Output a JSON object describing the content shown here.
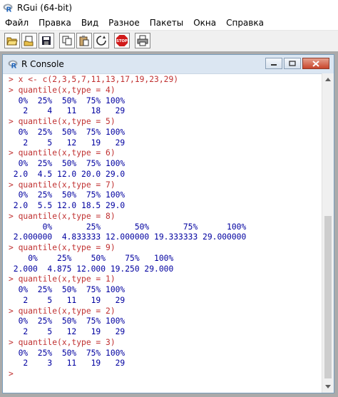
{
  "app": {
    "title": "RGui (64-bit)"
  },
  "menu": [
    "Файл",
    "Правка",
    "Вид",
    "Разное",
    "Пакеты",
    "Окна",
    "Справка"
  ],
  "toolbar": {
    "buttons": [
      "open-script-icon",
      "load-workspace-icon",
      "save-icon",
      "copy-icon",
      "paste-icon",
      "copy-paste-icon",
      "stop-icon",
      "print-icon"
    ],
    "stop_label": "STOP"
  },
  "console": {
    "title": "R Console",
    "lines": [
      {
        "type": "prompt",
        "text": "> x <- c(2,3,5,7,11,13,17,19,23,29)"
      },
      {
        "type": "prompt",
        "text": "> quantile(x,type = 4)"
      },
      {
        "type": "output",
        "text": "  0%  25%  50%  75% 100%"
      },
      {
        "type": "output",
        "text": "   2    4   11   18   29"
      },
      {
        "type": "prompt",
        "text": "> quantile(x,type = 5)"
      },
      {
        "type": "output",
        "text": "  0%  25%  50%  75% 100%"
      },
      {
        "type": "output",
        "text": "   2    5   12   19   29"
      },
      {
        "type": "prompt",
        "text": "> quantile(x,type = 6)"
      },
      {
        "type": "output",
        "text": "  0%  25%  50%  75% 100%"
      },
      {
        "type": "output",
        "text": " 2.0  4.5 12.0 20.0 29.0"
      },
      {
        "type": "prompt",
        "text": "> quantile(x,type = 7)"
      },
      {
        "type": "output",
        "text": "  0%  25%  50%  75% 100%"
      },
      {
        "type": "output",
        "text": " 2.0  5.5 12.0 18.5 29.0"
      },
      {
        "type": "prompt",
        "text": "> quantile(x,type = 8)"
      },
      {
        "type": "output",
        "text": "       0%       25%       50%       75%      100%"
      },
      {
        "type": "output",
        "text": " 2.000000  4.833333 12.000000 19.333333 29.000000"
      },
      {
        "type": "prompt",
        "text": "> quantile(x,type = 9)"
      },
      {
        "type": "output",
        "text": "    0%    25%    50%    75%   100%"
      },
      {
        "type": "output",
        "text": " 2.000  4.875 12.000 19.250 29.000"
      },
      {
        "type": "prompt",
        "text": "> quantile(x,type = 1)"
      },
      {
        "type": "output",
        "text": "  0%  25%  50%  75% 100%"
      },
      {
        "type": "output",
        "text": "   2    5   11   19   29"
      },
      {
        "type": "prompt",
        "text": "> quantile(x,type = 2)"
      },
      {
        "type": "output",
        "text": "  0%  25%  50%  75% 100%"
      },
      {
        "type": "output",
        "text": "   2    5   12   19   29"
      },
      {
        "type": "prompt",
        "text": "> quantile(x,type = 3)"
      },
      {
        "type": "output",
        "text": "  0%  25%  50%  75% 100%"
      },
      {
        "type": "output",
        "text": "   2    3   11   19   29"
      },
      {
        "type": "prompt",
        "text": "> "
      }
    ]
  },
  "colors": {
    "prompt": "#c03030",
    "output": "#0000a0",
    "titlebar": "#dbe6f2"
  }
}
